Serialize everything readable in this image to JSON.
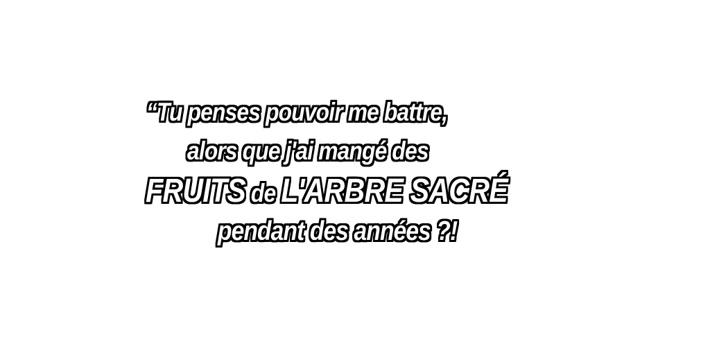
{
  "caption": {
    "line1": "“Tu penses pouvoir me battre,",
    "line2": "alors que j'ai mangé des",
    "line3_part1": "FRUITS",
    "line3_part2": " de ",
    "line3_part3": "L'ARBRE SACRÉ",
    "line4": "pendant des années ?!"
  }
}
